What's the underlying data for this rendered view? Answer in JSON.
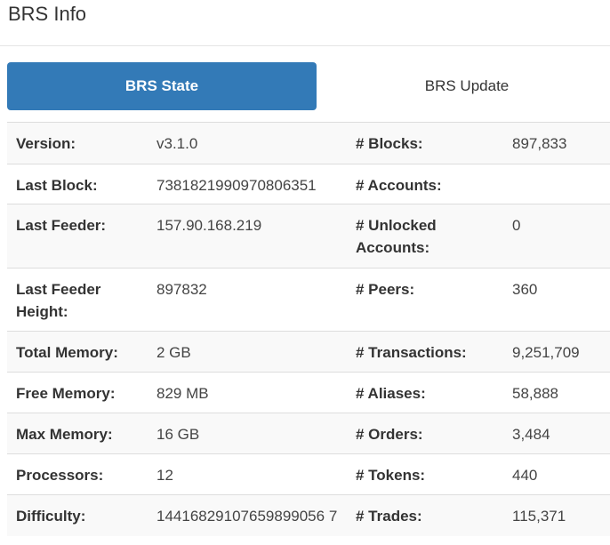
{
  "header": {
    "title": "BRS Info"
  },
  "tabs": [
    {
      "label": "BRS State",
      "active": true
    },
    {
      "label": "BRS Update",
      "active": false
    }
  ],
  "rows": [
    {
      "label1": "Version:",
      "value1": "v3.1.0",
      "label2": "# Blocks:",
      "value2": "897,833"
    },
    {
      "label1": "Last Block:",
      "value1": "7381821990970806351",
      "label2": "# Accounts:",
      "value2": ""
    },
    {
      "label1": "Last Feeder:",
      "value1": "157.90.168.219",
      "label2": "# Unlocked Accounts:",
      "value2": "0"
    },
    {
      "label1": "Last Feeder Height:",
      "value1": "897832",
      "label2": "# Peers:",
      "value2": "360"
    },
    {
      "label1": "Total Memory:",
      "value1": "2 GB",
      "label2": "# Transactions:",
      "value2": "9,251,709"
    },
    {
      "label1": "Free Memory:",
      "value1": "829 MB",
      "label2": "# Aliases:",
      "value2": "58,888"
    },
    {
      "label1": "Max Memory:",
      "value1": "16 GB",
      "label2": "# Orders:",
      "value2": "3,484"
    },
    {
      "label1": "Processors:",
      "value1": "12",
      "label2": "# Tokens:",
      "value2": "440"
    },
    {
      "label1": "Difficulty:",
      "value1": "14416829107659899056 7",
      "label2": "# Trades:",
      "value2": "115,371"
    }
  ],
  "colors": {
    "accent": "#337ab7",
    "stripe": "#f9f9f9",
    "border": "#dddddd"
  }
}
